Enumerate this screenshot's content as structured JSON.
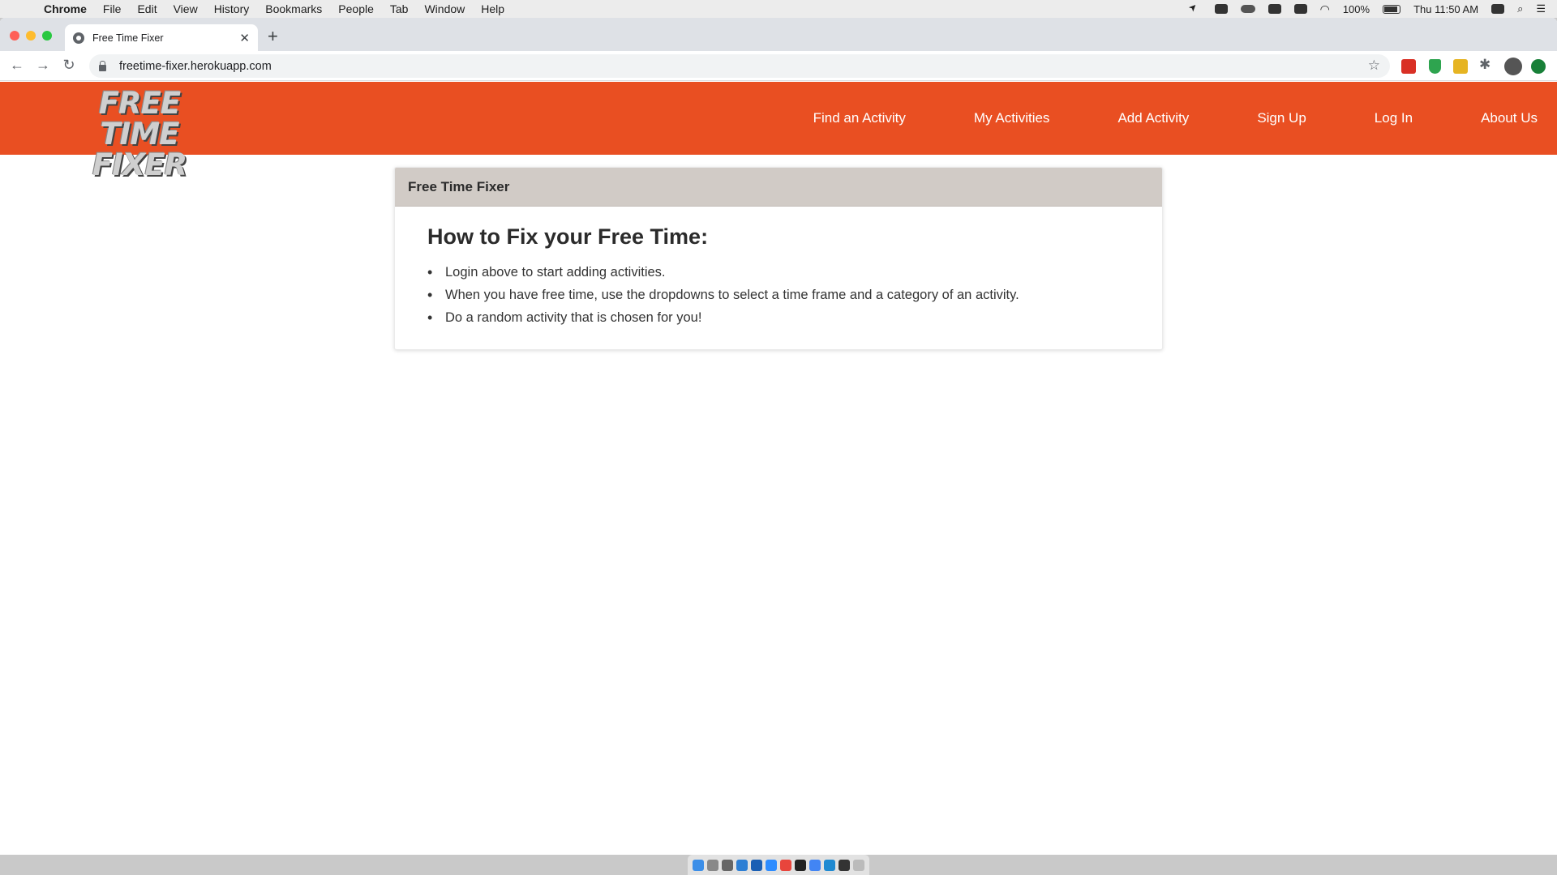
{
  "menubar": {
    "app_name": "Chrome",
    "items": [
      "File",
      "Edit",
      "View",
      "History",
      "Bookmarks",
      "People",
      "Tab",
      "Window",
      "Help"
    ],
    "battery": "100%",
    "clock": "Thu 11:50 AM"
  },
  "browser": {
    "tab_title": "Free Time Fixer",
    "url": "freetime-fixer.herokuapp.com"
  },
  "site": {
    "logo_line1": "FREE TIME",
    "logo_line2": "FIXER",
    "nav": [
      "Find an Activity",
      "My Activities",
      "Add Activity",
      "Sign Up",
      "Log In",
      "About Us"
    ],
    "accent_color": "#e94f22"
  },
  "card": {
    "header": "Free Time Fixer",
    "heading": "How to Fix your Free Time:",
    "steps": [
      "Login above to start adding activities.",
      "When you have free time, use the dropdowns to select a time frame and a category of an activity.",
      "Do a random activity that is chosen for you!"
    ]
  }
}
